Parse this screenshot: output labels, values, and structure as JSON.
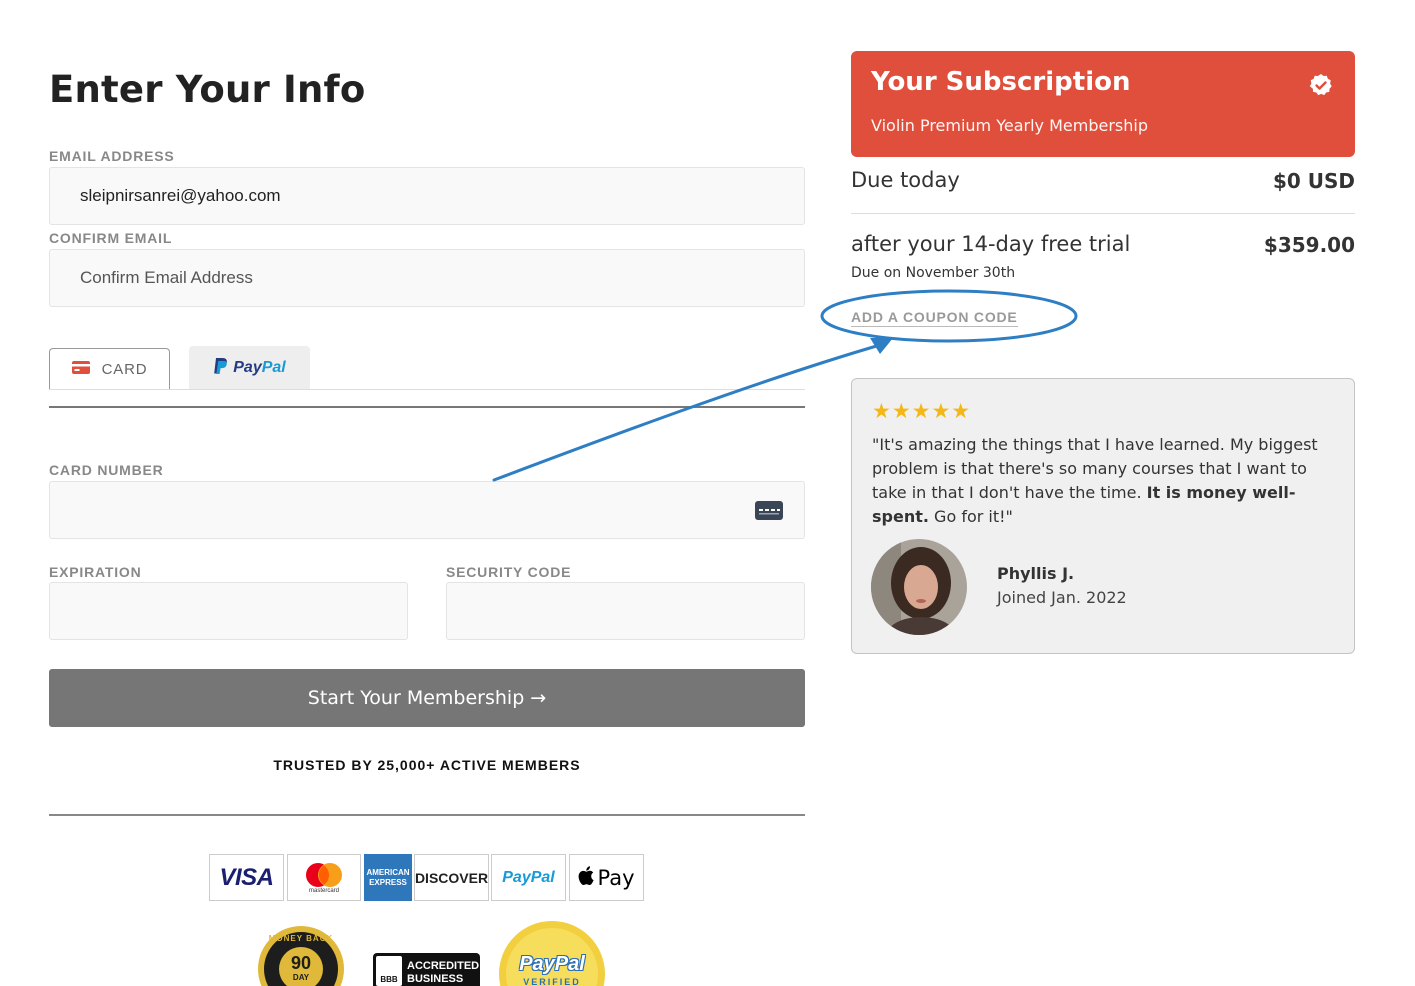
{
  "form": {
    "title": "Enter Your Info",
    "email_label": "EMAIL ADDRESS",
    "email_value": "sleipnirsanrei@yahoo.com",
    "confirm_label": "CONFIRM EMAIL",
    "confirm_placeholder": "Confirm Email Address",
    "tabs": {
      "card": "CARD",
      "paypal_p1": "Pay",
      "paypal_p2": "Pal"
    },
    "card_number_label": "CARD NUMBER",
    "expiration_label": "EXPIRATION",
    "security_label": "SECURITY CODE",
    "submit_label": "Start Your Membership →",
    "trusted_text": "TRUSTED BY 25,000+ ACTIVE MEMBERS"
  },
  "payment_logos": {
    "visa": "VISA",
    "mastercard": "mastercard",
    "amex_top": "AMERICAN",
    "amex_bottom": "EXPRESS",
    "discover": "DISCOVER",
    "paypal": "PayPal",
    "applepay": "Pay"
  },
  "badges": {
    "money_back_top": "MONEY BACK",
    "money_back_days": "90",
    "money_back_unit": "DAY",
    "bbb_line1": "ACCREDITED",
    "bbb_line2": "BUSINESS",
    "bbb_mark": "BBB",
    "paypal_verified_top": "PayPal",
    "paypal_verified_bottom": "VERIFIED"
  },
  "summary": {
    "title": "Your Subscription",
    "plan": "Violin Premium Yearly Membership",
    "due_today_label": "Due today",
    "due_today_value": "$0 USD",
    "trial_label": "after your 14-day free trial",
    "trial_value": "$359.00",
    "due_on": "Due on November 30th",
    "coupon_link": "ADD A COUPON CODE"
  },
  "review": {
    "stars": "★★★★★",
    "quote_start": "\"It's amazing the things that I have learned. My biggest problem is that there's so many courses that I want to take in that I don't have the time. ",
    "quote_bold": "It is money well-spent.",
    "quote_end": " Go for it!\"",
    "name": "Phyllis J.",
    "joined": "Joined Jan. 2022"
  },
  "colors": {
    "accent_red": "#e04e3c",
    "annotation_blue": "#2e7ec4",
    "star_gold": "#f3b816"
  }
}
